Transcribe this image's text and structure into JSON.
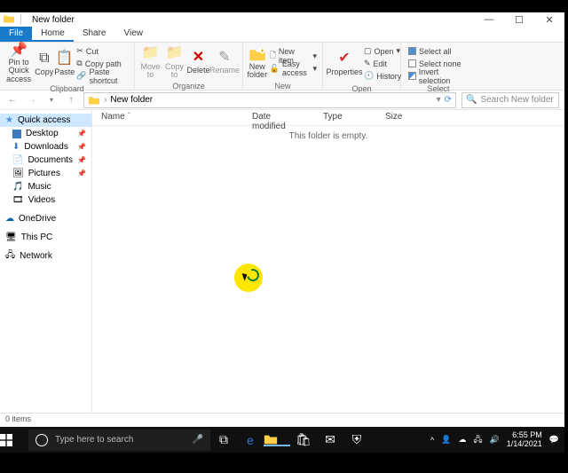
{
  "titlebar": {
    "title": "New folder",
    "controls": {
      "min": "—",
      "max": "☐",
      "close": "✕"
    }
  },
  "tabs": {
    "file": "File",
    "home": "Home",
    "share": "Share",
    "view": "View"
  },
  "ribbon": {
    "clipboard": {
      "label": "Clipboard",
      "pin": "Pin to Quick access",
      "copy": "Copy",
      "paste": "Paste",
      "cut": "Cut",
      "copy_path": "Copy path",
      "paste_shortcut": "Paste shortcut"
    },
    "organize": {
      "label": "Organize",
      "move_to": "Move to",
      "copy_to": "Copy to",
      "delete": "Delete",
      "rename": "Rename"
    },
    "new": {
      "label": "New",
      "new_folder": "New folder",
      "new_item": "New item",
      "easy_access": "Easy access"
    },
    "open": {
      "label": "Open",
      "properties": "Properties",
      "open": "Open",
      "edit": "Edit",
      "history": "History"
    },
    "select": {
      "label": "Select",
      "select_all": "Select all",
      "select_none": "Select none",
      "invert": "Invert selection"
    }
  },
  "address": {
    "folder": "New folder",
    "search_placeholder": "Search New folder"
  },
  "nav": {
    "quick_access": "Quick access",
    "desktop": "Desktop",
    "downloads": "Downloads",
    "documents": "Documents",
    "pictures": "Pictures",
    "music": "Music",
    "videos": "Videos",
    "onedrive": "OneDrive",
    "this_pc": "This PC",
    "network": "Network"
  },
  "columns": {
    "name": "Name",
    "date": "Date modified",
    "type": "Type",
    "size": "Size"
  },
  "content": {
    "empty": "This folder is empty."
  },
  "status": {
    "items": "0 items"
  },
  "taskbar": {
    "search_placeholder": "Type here to search",
    "time": "6:55 PM",
    "date": "1/14/2021"
  }
}
